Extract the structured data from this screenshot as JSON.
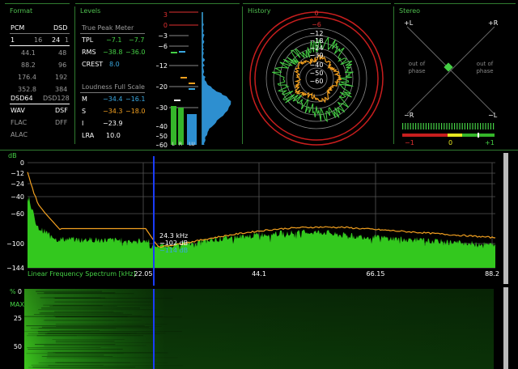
{
  "format": {
    "title": "Format",
    "pcm": "PCM",
    "dsd": "DSD",
    "row1": [
      "1",
      "16",
      "24",
      "1"
    ],
    "rates": [
      [
        "44.1",
        "48"
      ],
      [
        "88.2",
        "96"
      ],
      [
        "176.4",
        "192"
      ],
      [
        "352.8",
        "384"
      ]
    ],
    "dsd64": "DSD64",
    "dsd128": "DSD128",
    "wav": "WAV",
    "dsf": "DSF",
    "flac": "FLAC",
    "dff": "DFF",
    "alac": "ALAC"
  },
  "levels": {
    "title": "Levels",
    "tpm_title": "True Peak Meter",
    "tpl_label": "TPL",
    "tpl_l": "−7.1",
    "tpl_r": "−7.7",
    "rms_label": "RMS",
    "rms_l": "−38.8",
    "rms_r": "−36.0",
    "crest_label": "CREST",
    "crest": "8.0",
    "lfs_title": "Loudness Full Scale",
    "m_label": "M",
    "m_a": "−34.4",
    "m_b": "−16.1",
    "s_label": "S",
    "s_a": "−34.3",
    "s_b": "−18.0",
    "i_label": "I",
    "i_a": "−23.9",
    "lra_label": "LRA",
    "lra": "10.0",
    "scale_top": [
      "3",
      "0",
      "−3",
      "−6"
    ],
    "scale": [
      "−12",
      "−20",
      "−30",
      "−40",
      "−50",
      "−60"
    ],
    "bar_l": "L",
    "bar_r": "R",
    "bar_lu": "LU"
  },
  "history": {
    "title": "History",
    "rings": [
      "0",
      "−6",
      "−12",
      "−18",
      "−24",
      "−30",
      "−40",
      "−50",
      "−60"
    ]
  },
  "stereo": {
    "title": "Stereo",
    "pl": "+L",
    "pr": "+R",
    "ml": "−R",
    "mr": "−L",
    "oop_left": "out of\nphase",
    "oop_right": "out of\nphase",
    "corr_min": "−1",
    "corr_mid": "0",
    "corr_max": "+1",
    "correlation": 0.65
  },
  "spectrum": {
    "db_label": "dB",
    "y_ticks": [
      "0",
      "−12",
      "−24",
      "−40",
      "−60",
      "−100",
      "−144"
    ],
    "x_title": "Linear Frequency Spectrum [kHz]",
    "x_ticks": [
      "22.05",
      "44.1",
      "66.15",
      "88.2"
    ],
    "cursor_freq": "24.3 kHz",
    "cursor_db1": "−102 dB",
    "cursor_db2": "−114 dB",
    "colors": {
      "fill": "#33c81e",
      "peak": "#f2a020",
      "cursor": "#1a3cff"
    }
  },
  "waterfall": {
    "pct": "%",
    "y_ticks": [
      "0",
      "MAX",
      "25",
      "50"
    ]
  }
}
